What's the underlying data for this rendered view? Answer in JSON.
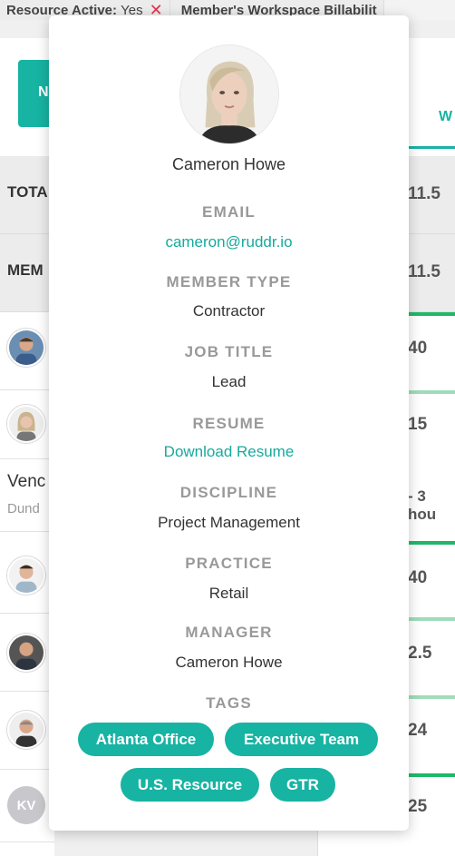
{
  "filters": {
    "resource_active_label": "Resource Active:",
    "resource_active_value": "Yes",
    "remove_icon": "close-icon",
    "workspace_billability": "Member's Workspace Billabilit"
  },
  "background": {
    "action_button_fragment": "N",
    "total_label": "TOTA",
    "members_label": "MEM",
    "vendor_name": "Venc",
    "vendor_company": "Dund",
    "kv_initials": "KV",
    "right_tab": "W",
    "right_values": [
      "11.5",
      "11.5",
      "40",
      "15",
      "- 3 hou",
      "40",
      "2.5",
      "24",
      "25"
    ]
  },
  "profile": {
    "name": "Cameron Howe",
    "email_label": "EMAIL",
    "email": "cameron@ruddr.io",
    "member_type_label": "MEMBER TYPE",
    "member_type": "Contractor",
    "job_title_label": "JOB TITLE",
    "job_title": "Lead",
    "resume_label": "RESUME",
    "resume_link": "Download Resume",
    "discipline_label": "DISCIPLINE",
    "discipline": "Project Management",
    "practice_label": "PRACTICE",
    "practice": "Retail",
    "manager_label": "MANAGER",
    "manager": "Cameron Howe",
    "tags_label": "TAGS",
    "tags": [
      "Atlanta Office",
      "Executive Team",
      "U.S. Resource",
      "GTR"
    ]
  },
  "colors": {
    "accent": "#17b3a3",
    "link": "#17a99c",
    "remove": "#e0354b",
    "progress_green": "#1fb86a"
  }
}
